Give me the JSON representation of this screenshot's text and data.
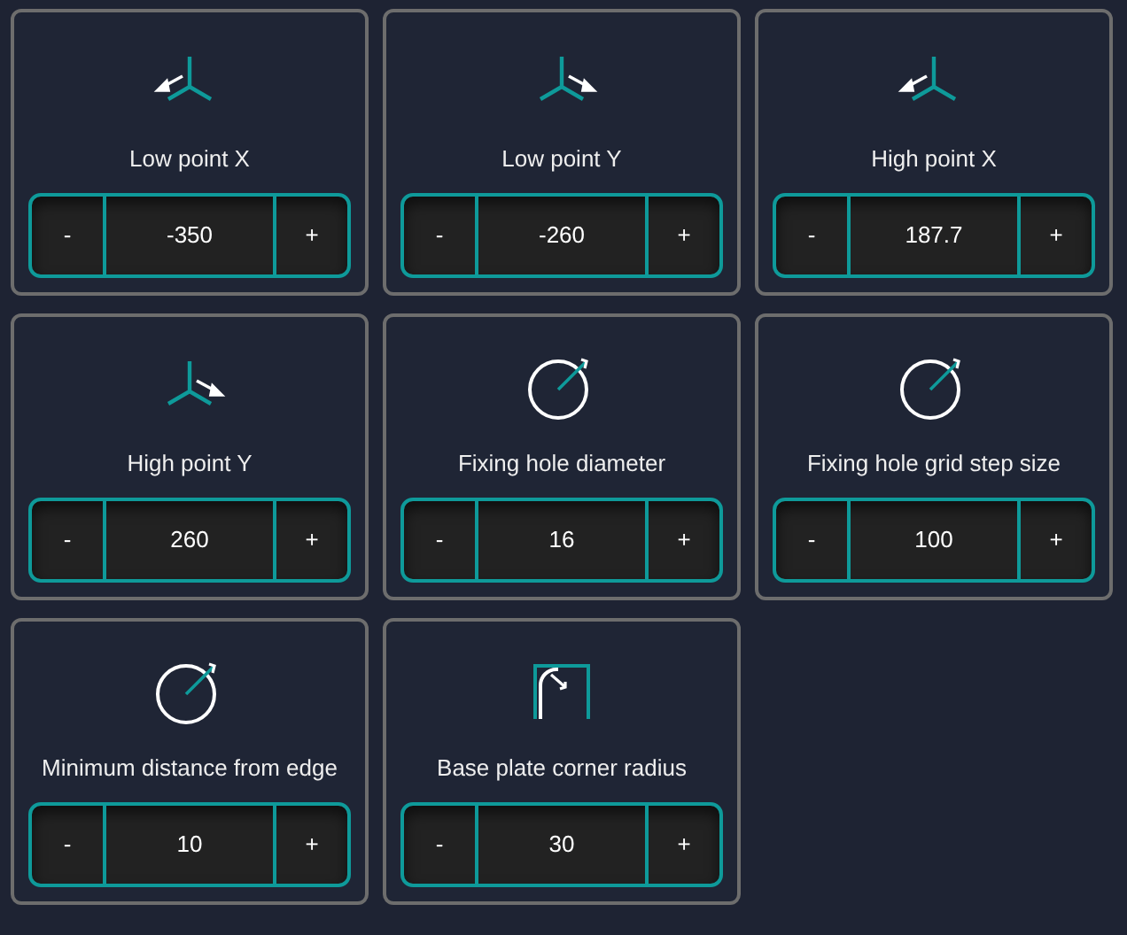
{
  "fields": [
    {
      "kind": "axis_left",
      "label": "Low point X",
      "minus": "-",
      "value": "-350",
      "plus": "+"
    },
    {
      "kind": "axis_right",
      "label": "Low point Y",
      "minus": "-",
      "value": "-260",
      "plus": "+"
    },
    {
      "kind": "axis_left",
      "label": "High point X",
      "minus": "-",
      "value": "187.7",
      "plus": "+"
    },
    {
      "kind": "axis_right",
      "label": "High point Y",
      "minus": "-",
      "value": "260",
      "plus": "+"
    },
    {
      "kind": "circle",
      "label": "Fixing hole diameter",
      "minus": "-",
      "value": "16",
      "plus": "+"
    },
    {
      "kind": "circle",
      "label": "Fixing hole grid step size",
      "minus": "-",
      "value": "100",
      "plus": "+"
    },
    {
      "kind": "circle",
      "label": "Minimum distance from edge",
      "minus": "-",
      "value": "10",
      "plus": "+"
    },
    {
      "kind": "corner",
      "label": "Base plate corner radius",
      "minus": "-",
      "value": "30",
      "plus": "+"
    }
  ]
}
